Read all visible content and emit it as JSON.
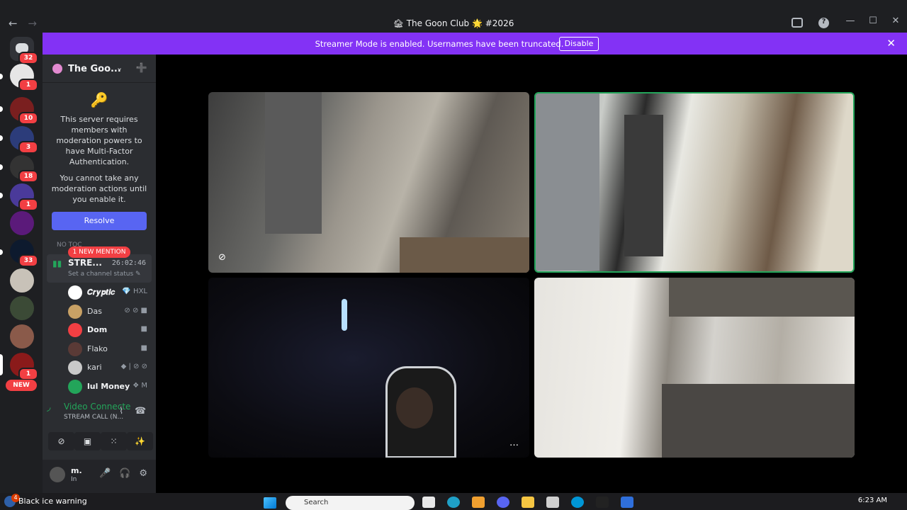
{
  "window": {
    "title": "🏚 The Goon Club 🌟 #2026",
    "back": "←",
    "forward": "→",
    "help": "?",
    "minimize": "—",
    "maximize": "☐",
    "close": "✕"
  },
  "banner": {
    "message": "Streamer Mode is enabled. Usernames have been truncated.",
    "disable_label": "Disable",
    "close": "✕"
  },
  "guilds": {
    "home_badge": "32",
    "badges": [
      "1",
      "10",
      "3",
      "18",
      "1",
      "33",
      "1"
    ],
    "new_label": "NEW"
  },
  "server": {
    "name": "The Goo...",
    "chevron": "⌄",
    "invite_icon": "➕"
  },
  "mfa": {
    "key_icon": "🔑",
    "text1": "This server requires members with moderation powers to have Multi-Factor Authentication.",
    "text2": "You cannot take any moderation actions until you enable it.",
    "resolve_label": "Resolve"
  },
  "channel": {
    "no_topic": "NO TOC",
    "mention_label": "1 NEW MENTION",
    "name": "STRE...",
    "timer": "26:02:46",
    "status_placeholder": "Set a channel status ✎"
  },
  "members": [
    {
      "name": "𝑪𝒓𝒚𝒑𝒕𝒊𝒄",
      "icons": "💎 HXL",
      "color": "#ffffff"
    },
    {
      "name": "Das",
      "icons": "⊘ ⊘ ■",
      "color": "#c8a165"
    },
    {
      "name": "Dom",
      "icons": "■",
      "color": "#f23f43"
    },
    {
      "name": "Flako",
      "icons": "■",
      "color": "#5a3a36"
    },
    {
      "name": "kari",
      "icons": "◆ | ⊘ ⊘",
      "color": "#c9c9c9"
    },
    {
      "name": "lul Money",
      "icons": "❖ M",
      "color": "#23a55a"
    }
  ],
  "voice": {
    "status": "Video Connecte",
    "sub": "STREAM CALL (N...",
    "signal_icon": "◞",
    "noise_icon": "⌇",
    "disconnect_icon": "☎",
    "actions": [
      "⊘",
      "▣",
      "⁙",
      "✨"
    ]
  },
  "user": {
    "name": "m.",
    "status": "In",
    "mic_icon": "🎤",
    "headset_icon": "🎧",
    "settings_icon": "⚙",
    "caret": "˅"
  },
  "tiles": {
    "camera_off_icon": "⊘",
    "more_icon": "…"
  },
  "taskbar": {
    "weather_badge": "4",
    "weather": "Black ice warning",
    "search_placeholder": "Search",
    "clock": "6:23 AM"
  }
}
